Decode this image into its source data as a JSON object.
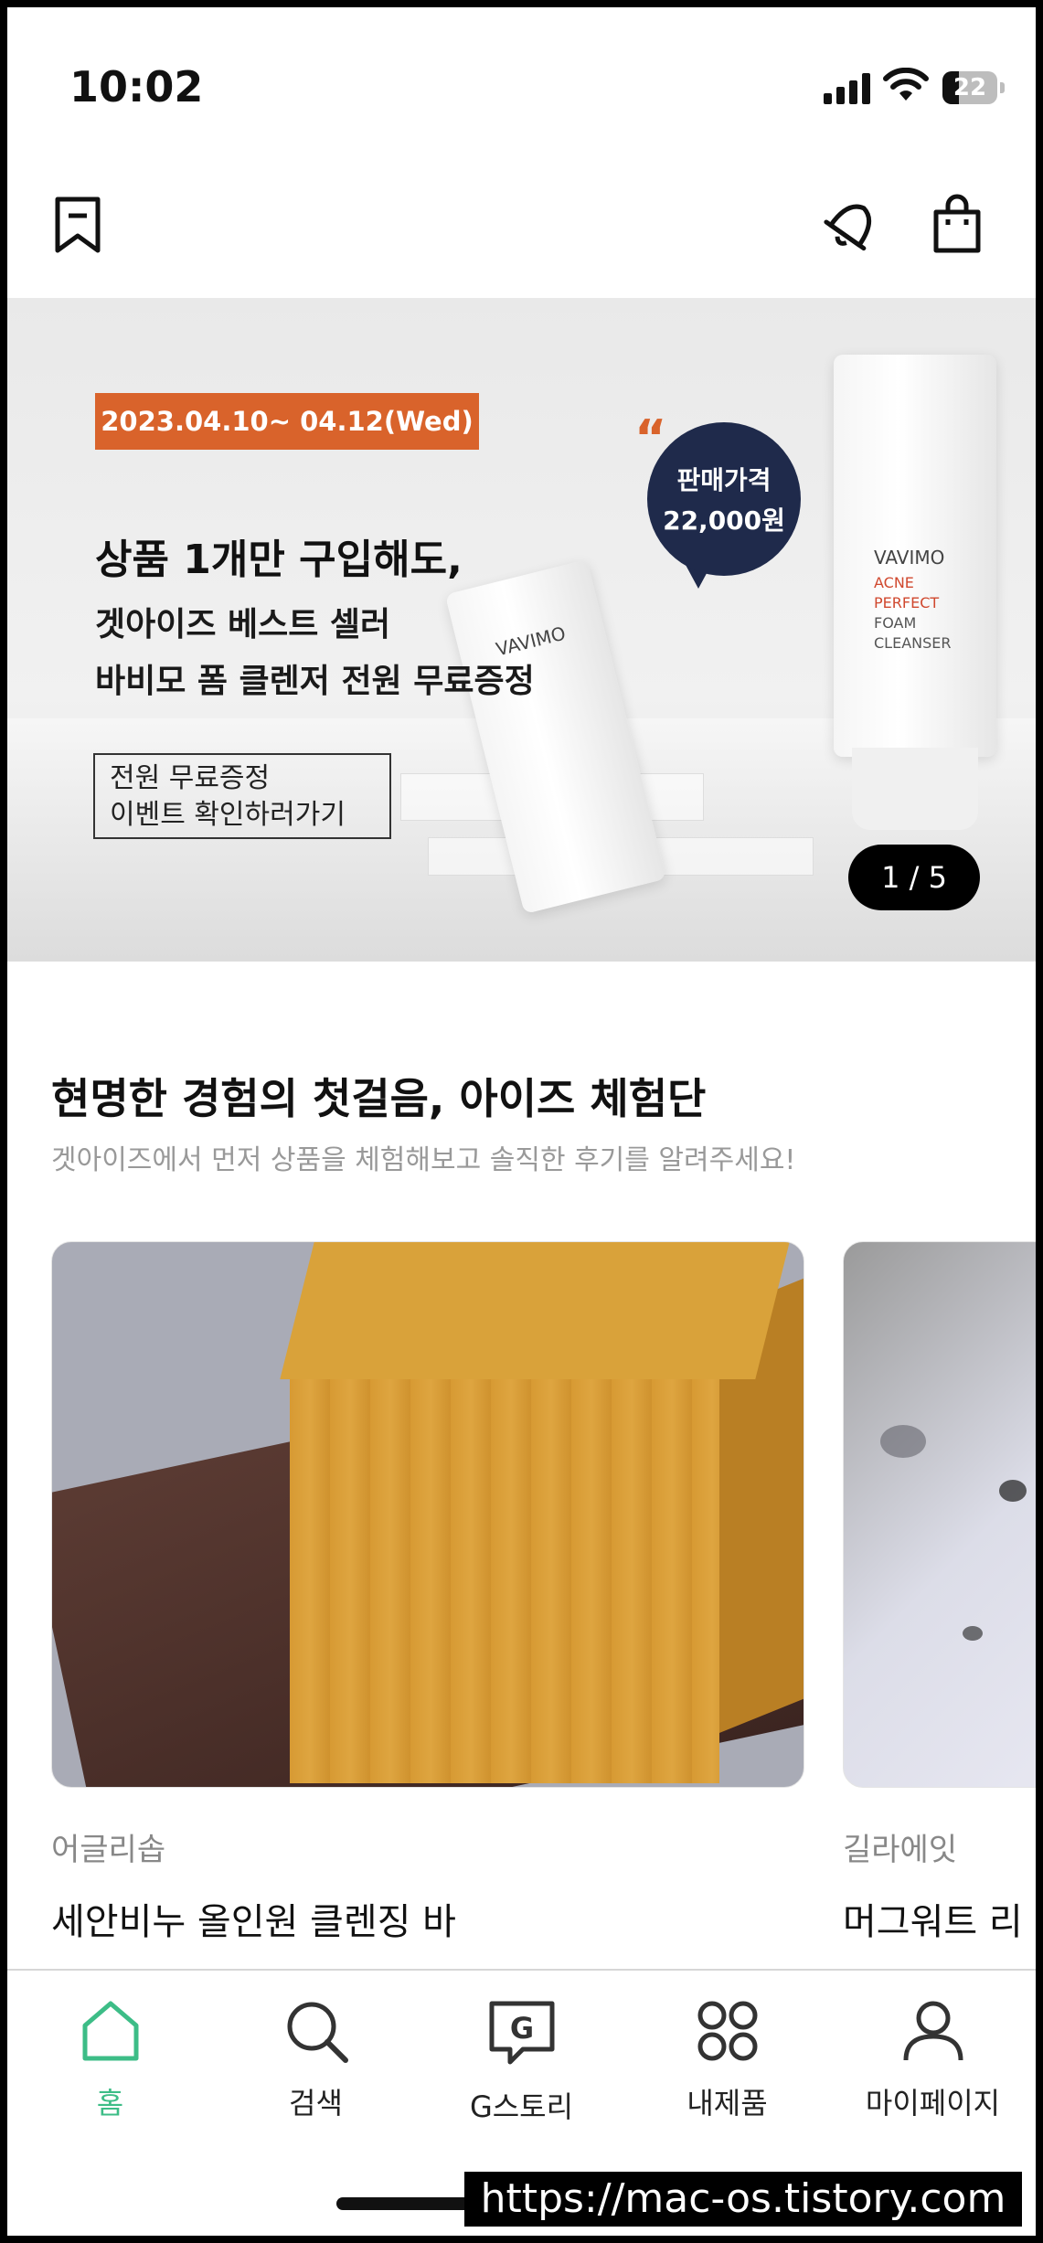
{
  "status_bar": {
    "time": "10:02",
    "battery": "22"
  },
  "banner": {
    "date": "2023.04.10~ 04.12(Wed)",
    "headline": "상품 1개만 구입해도,",
    "subline1": "겟아이즈 베스트 셀러",
    "subline2": "바비모 폼 클렌저 전원 무료증정",
    "event_line1": "전원 무료증정",
    "event_line2": "이벤트 확인하러가기",
    "price_label": "판매가격",
    "price_value": "22,000원",
    "product_brand": "VAVIMO",
    "product_lines": [
      "ACNE",
      "PERFECT",
      "FOAM",
      "CLEANSER"
    ],
    "slide_counter": "1 / 5"
  },
  "section": {
    "title": "현명한 경험의 첫걸음, 아이즈 체험단",
    "subtitle": "겟아이즈에서 먼저 상품을 체험해보고 솔직한 후기를 알려주세요!"
  },
  "cards": [
    {
      "brand": "어글리솝",
      "name": "세안비누 올인원 클렌징 바"
    },
    {
      "brand": "길라에잇",
      "name": "머그워트 리"
    }
  ],
  "tabs": [
    {
      "label": "홈",
      "icon": "home-icon",
      "active": true
    },
    {
      "label": "검색",
      "icon": "search-icon"
    },
    {
      "label": "G스토리",
      "icon": "g-story-icon"
    },
    {
      "label": "내제품",
      "icon": "my-products-icon"
    },
    {
      "label": "마이페이지",
      "icon": "profile-icon"
    }
  ],
  "watermark": "https://mac-os.tistory.com",
  "colors": {
    "accent": "#3dbd87",
    "banner_orange": "#d9632b",
    "bubble_navy": "#1f2a4b"
  }
}
